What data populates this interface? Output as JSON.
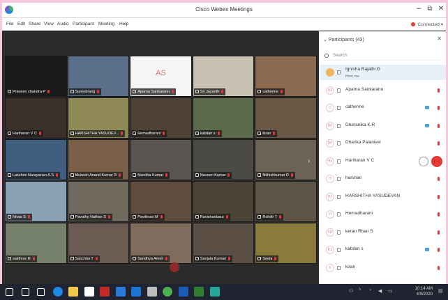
{
  "window": {
    "title": "Cisco Webex Meetings",
    "controls": [
      "–",
      "⧉",
      "✕"
    ]
  },
  "menubar": {
    "items": [
      "File",
      "Edit",
      "Share",
      "View",
      "Audio",
      "Participant",
      "Meeting",
      "Help"
    ],
    "status": "Connected"
  },
  "video_grid": [
    {
      "name": "Praveen chandra P",
      "bg": "#1a1a1a"
    },
    {
      "name": "Surendrang",
      "bg": "#5b6e8a"
    },
    {
      "name": "Aparna Sankaranu",
      "bg": "#f5f5f5",
      "initials": "AS"
    },
    {
      "name": "Sri Jayanth",
      "bg": "#c8c1b2"
    },
    {
      "name": "catherine",
      "bg": "#8c6a4f"
    },
    {
      "name": "Hariharan V C",
      "bg": "#3b2f2a"
    },
    {
      "name": "HARSHITHA YASUDEV...",
      "bg": "#8f8a55"
    },
    {
      "name": "Hemadharani",
      "bg": "#4e4235"
    },
    {
      "name": "kabilan s",
      "bg": "#5c6a4c"
    },
    {
      "name": "kiran",
      "bg": "#6a5846"
    },
    {
      "name": "Lakshmi Narayanan A.S",
      "bg": "#3f5e80"
    },
    {
      "name": "Mukesh Anand Kumar R",
      "bg": "#7a6048"
    },
    {
      "name": "Nandha Kumar",
      "bg": "#5a5550"
    },
    {
      "name": "Naveen Kumar",
      "bg": "#4b4a46"
    },
    {
      "name": "Nithishkumar R",
      "bg": "#6c6256"
    },
    {
      "name": "Nivas S",
      "bg": "#8aa0b4"
    },
    {
      "name": "Pavathy Nathan S",
      "bg": "#6f6a5d"
    },
    {
      "name": "Pavithran M",
      "bg": "#5f4c3e"
    },
    {
      "name": "Ravishanbaru",
      "bg": "#4d4438"
    },
    {
      "name": "Rohith T",
      "bg": "#5e5446"
    },
    {
      "name": "sakthive R",
      "bg": "#74806a"
    },
    {
      "name": "Sanchita T",
      "bg": "#6b5b52"
    },
    {
      "name": "Sandhya Ameli",
      "bg": "#7f6c5c"
    },
    {
      "name": "Sanjala Kumari",
      "bg": "#5b4f45"
    },
    {
      "name": "Seela",
      "bg": "#8a7a3c"
    }
  ],
  "participants_panel": {
    "header": "Participants (43)",
    "search_placeholder": "Search",
    "close_icon": "✕",
    "participants": [
      {
        "name": "Ignisha Rajathi G",
        "sub": "Host, me",
        "initials": "",
        "active": true,
        "cam": false
      },
      {
        "name": "Aparna Sankaranu",
        "initials": "AS",
        "cam": false
      },
      {
        "name": "catherine",
        "initials": "C",
        "cam": true
      },
      {
        "name": "Dharanika K.R",
        "initials": "DK",
        "cam": true
      },
      {
        "name": "Dharika Palanivel",
        "initials": "DP",
        "cam": false
      },
      {
        "name": "Hariharan V C",
        "initials": "HV",
        "cam": false,
        "hover": true
      },
      {
        "name": "harshan",
        "initials": "H",
        "cam": false
      },
      {
        "name": "HARSHITHA YASUDEVAN",
        "initials": "HY",
        "cam": false
      },
      {
        "name": "Hemadharani",
        "initials": "H",
        "cam": false
      },
      {
        "name": "keran Rhari S",
        "initials": "KR",
        "cam": false
      },
      {
        "name": "kabilan s",
        "initials": "KS",
        "cam": true
      },
      {
        "name": "kiran",
        "initials": "K",
        "cam": false
      }
    ]
  },
  "taskbar": {
    "time": "10:14 AM",
    "date": "4/9/2020",
    "icons": [
      {
        "name": "windows-start",
        "color": "#ffffff"
      },
      {
        "name": "search",
        "color": "#ffffff"
      },
      {
        "name": "task-view",
        "color": "#ffffff"
      },
      {
        "name": "edge",
        "color": "#1e88e5"
      },
      {
        "name": "file-explorer",
        "color": "#f2c94c"
      },
      {
        "name": "store",
        "color": "#ffffff"
      },
      {
        "name": "mcafee",
        "color": "#c62828"
      },
      {
        "name": "mail",
        "color": "#2b7bd6"
      },
      {
        "name": "app-blue",
        "color": "#1976d2"
      },
      {
        "name": "app-grey",
        "color": "#bdbdbd"
      },
      {
        "name": "chrome",
        "color": "#4caf50"
      },
      {
        "name": "word",
        "color": "#1e5bb8"
      },
      {
        "name": "excel",
        "color": "#2e7d32"
      },
      {
        "name": "webex",
        "color": "#26a69a"
      }
    ]
  }
}
